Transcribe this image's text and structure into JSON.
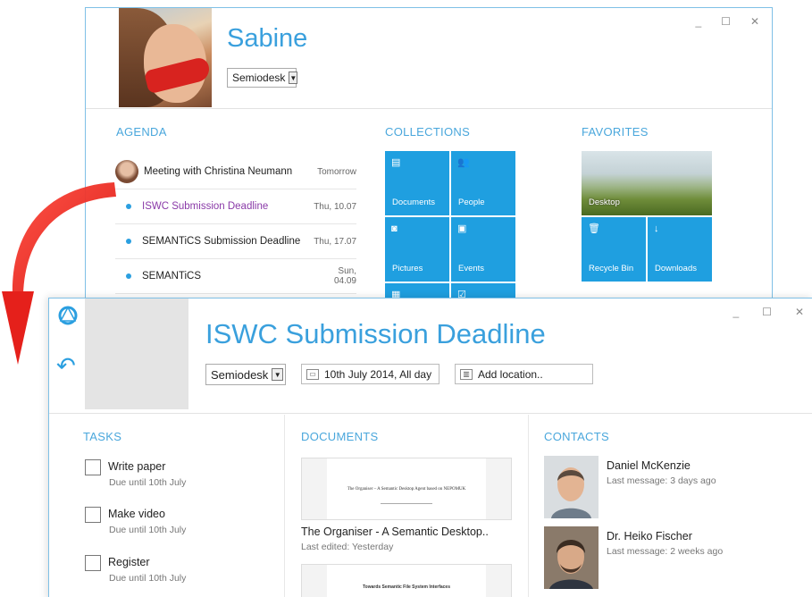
{
  "back_window": {
    "name": "Sabine",
    "account_select": "Semiodesk",
    "controls": {
      "minimize": "_",
      "maximize": "☐",
      "close": "✕"
    },
    "agenda": {
      "title": "AGENDA",
      "items": [
        {
          "label": "Meeting with Christina Neumann",
          "date": "Tomorrow"
        },
        {
          "label": "ISWC Submission Deadline",
          "date": "Thu, 10.07"
        },
        {
          "label": "SEMANTiCS Submission Deadline",
          "date": "Thu, 17.07"
        },
        {
          "label": "SEMANTiCS",
          "date": "Sun, 04.09"
        }
      ]
    },
    "collections": {
      "title": "COLLECTIONS",
      "tiles": [
        {
          "label": "Documents",
          "icon": "document-icon"
        },
        {
          "label": "People",
          "icon": "people-icon"
        },
        {
          "label": "Pictures",
          "icon": "camera-icon"
        },
        {
          "label": "Events",
          "icon": "calendar-icon"
        },
        {
          "label": "",
          "icon": "film-icon"
        },
        {
          "label": "",
          "icon": "checklist-icon"
        }
      ]
    },
    "favorites": {
      "title": "FAVORITES",
      "tiles": [
        {
          "label": "Desktop",
          "icon": "desktop-photo"
        },
        {
          "label": "Recycle Bin",
          "icon": "trash-icon"
        },
        {
          "label": "Downloads",
          "icon": "download-icon"
        }
      ]
    }
  },
  "front_window": {
    "title": "ISWC Submission Deadline",
    "account_select": "Semiodesk",
    "date_field": "10th July 2014, All day",
    "location_placeholder": "Add location..",
    "controls": {
      "minimize": "_",
      "maximize": "☐",
      "close": "✕"
    },
    "tasks": {
      "title": "TASKS",
      "items": [
        {
          "name": "Write paper",
          "due": "Due until 10th July"
        },
        {
          "name": "Make video",
          "due": "Due until 10th July"
        },
        {
          "name": "Register",
          "due": "Due until 10th July"
        }
      ]
    },
    "documents": {
      "title": "DOCUMENTS",
      "items": [
        {
          "title": "The Organiser - A Semantic Desktop..",
          "meta": "Last edited: Yesterday",
          "thumb_heading": "The Organiser – A Semantic Desktop Agent based on NEPOMUK"
        },
        {
          "title": "",
          "meta": "",
          "thumb_heading": "Towards Semantic File System Interfaces"
        }
      ]
    },
    "contacts": {
      "title": "CONTACTS",
      "items": [
        {
          "name": "Daniel McKenzie",
          "last_message": "Last message: 3 days ago"
        },
        {
          "name": "Dr. Heiko Fischer",
          "last_message": "Last message: 2 weeks ago"
        }
      ]
    }
  },
  "colors": {
    "accent": "#2b9fe0",
    "tile": "#1f9fe0",
    "title_text": "#3aa0dd",
    "active_agenda": "#8a3aa8",
    "arrow": "#e5201b"
  }
}
